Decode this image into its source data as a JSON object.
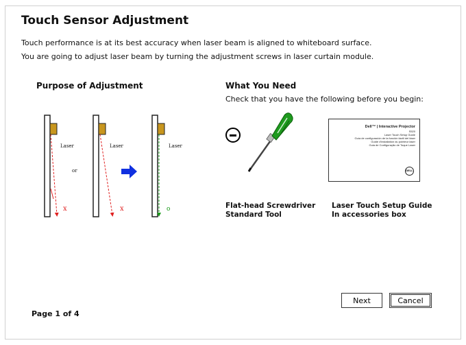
{
  "header": {
    "title": "Touch Sensor Adjustment",
    "line1": "Touch performance is at its best accuracy when laser beam is aligned to whiteboard surface.",
    "line2": "You are going to adjust laser beam by turning the adjustment screws in laser curtain module."
  },
  "purpose": {
    "title": "Purpose of Adjustment",
    "diagram": {
      "laser_label": "Laser",
      "or_label": "or",
      "wrong_mark": "x",
      "right_mark": "o",
      "colors": {
        "laser_wrong": "#e02020",
        "laser_right": "#1a9b1a",
        "arrow": "#1030e0",
        "module": "#c8961e"
      }
    }
  },
  "need": {
    "title": "What You Need",
    "subtitle": "Check that you have the following before you begin:",
    "items": [
      {
        "icon": "flat-head-screwdriver-icon",
        "label_line1": "Flat-head Screwdriver",
        "label_line2": "Standard Tool"
      },
      {
        "icon": "setup-guide-icon",
        "label_line1": "Laser Touch Setup Guide",
        "label_line2": "In accessories box"
      }
    ],
    "guide_cover": {
      "title": "Dell™ | Interactive Projector",
      "model": "S520",
      "lines": [
        "Laser Touch Setup Guide",
        "Guía de configuración de la función táctil del láser",
        "Guide d'installation du pointeur laser",
        "Guia de Configuração de Toque Laser"
      ],
      "logo": "DELL"
    }
  },
  "footer": {
    "page": "Page 1 of 4",
    "next_label": "Next",
    "cancel_label": "Cancel"
  }
}
